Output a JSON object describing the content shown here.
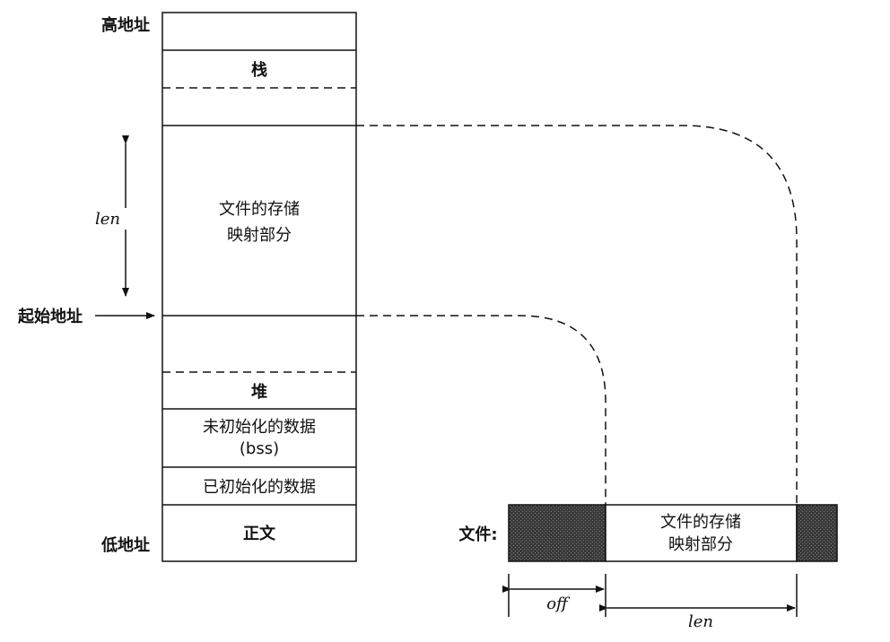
{
  "memory": {
    "high_address": "高地址",
    "low_address": "低地址",
    "start_address": "起始地址",
    "stack": "栈",
    "mapped_line1": "文件的存储",
    "mapped_line2": "映射部分",
    "heap": "堆",
    "bss_line1": "未初始化的数据",
    "bss_line2": "(bss)",
    "data": "已初始化的数据",
    "text": "正文",
    "len": "len"
  },
  "file": {
    "label": "文件:",
    "mapped_line1": "文件的存储",
    "mapped_line2": "映射部分",
    "off": "off",
    "len": "len"
  }
}
